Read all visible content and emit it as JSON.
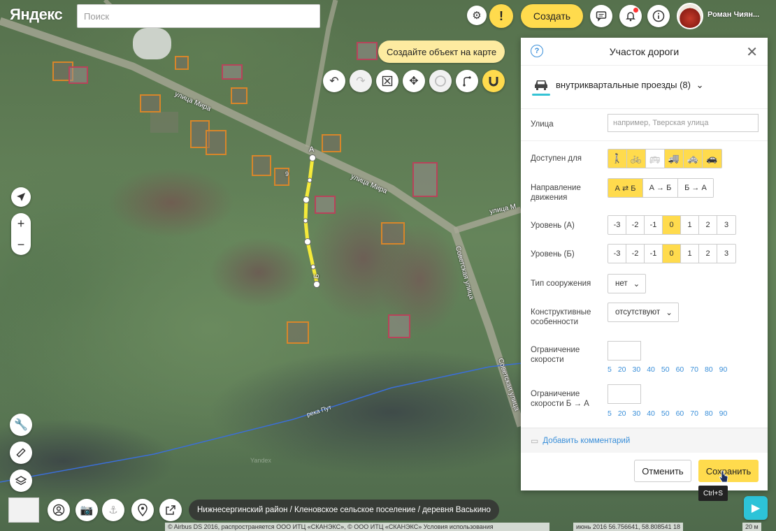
{
  "header": {
    "logo": "Яндекс",
    "search_placeholder": "Поиск",
    "warning_glyph": "!",
    "create_label": "Создать",
    "user_name": "Роман Чиян..."
  },
  "map": {
    "tooltip": "Создайте объект на карте",
    "streets": [
      "улица Мира",
      "улица Мира",
      "улица М",
      "Советская улица",
      "Советская улица"
    ],
    "river": "река Пут",
    "watermark": "Yandex",
    "point_a": "А",
    "point_b": "Б",
    "house_numbers": [
      "9"
    ]
  },
  "tools": [
    "undo-icon",
    "redo-icon",
    "delete-icon",
    "move-icon",
    "circle-icon",
    "branch-icon",
    "magnet-icon"
  ],
  "panel": {
    "title": "Участок дороги",
    "help": "?",
    "road_type": "внутриквартальные проезды (8)",
    "street_label": "Улица",
    "street_placeholder": "например, Тверская улица",
    "access_label": "Доступен для",
    "access_options": [
      {
        "icon": "pedestrian-icon",
        "glyph": "🚶",
        "on": true
      },
      {
        "icon": "bicycle-icon",
        "glyph": "🚲",
        "on": true
      },
      {
        "icon": "bus-icon",
        "glyph": "🚌",
        "on": false
      },
      {
        "icon": "truck-icon",
        "glyph": "🚚",
        "on": true
      },
      {
        "icon": "taxi-icon",
        "glyph": "🚕",
        "on": true
      },
      {
        "icon": "car-icon",
        "glyph": "🚗",
        "on": true
      }
    ],
    "direction_label": "Направление движения",
    "direction_options": [
      "А ⇄ Б",
      "А → Б",
      "Б → А"
    ],
    "direction_selected": 0,
    "level_a_label": "Уровень (А)",
    "level_b_label": "Уровень (Б)",
    "levels": [
      "-3",
      "-2",
      "-1",
      "0",
      "1",
      "2",
      "3"
    ],
    "level_selected": "0",
    "structure_label": "Тип сооружения",
    "structure_value": "нет",
    "features_label": "Конструктивные особенности",
    "features_value": "отсутствуют",
    "speed_label": "Ограничение скорости",
    "speed_ba_label": "Ограничение скорости Б → А",
    "speeds": [
      "5",
      "20",
      "30",
      "40",
      "50",
      "60",
      "70",
      "80",
      "90"
    ],
    "comment": "Добавить комментарий",
    "cancel": "Отменить",
    "save": "Сохранить",
    "shortcut": "Ctrl+S"
  },
  "bottom": {
    "breadcrumb": "Нижнесергинский район / Кленовское сельское поселение / деревня Васькино",
    "copyright": "© Airbus DS 2016, распространяется ООО ИТЦ «СКАНЭКС», © ООО ИТЦ «СКАНЭКС» Условия использования",
    "coords": "июнь 2016   56.756641, 58.808541   18",
    "scale": "20 м"
  },
  "colors": {
    "accent": "#ffdb4d",
    "link": "#3a8fd9",
    "road": "#f5ea3a",
    "house_outline": "#d8862a"
  }
}
